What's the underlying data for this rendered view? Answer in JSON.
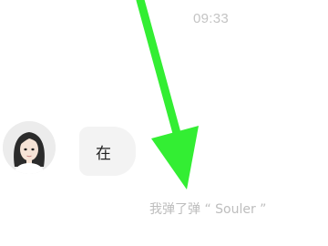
{
  "chat": {
    "timestamp": "09:33",
    "message": {
      "sender_avatar": "female-avatar",
      "text": "在"
    },
    "system_notice": "我弹了弹 “ Souler ”"
  },
  "overlay": {
    "arrow_color": "#33ee33",
    "arrow_icon": "green-arrow-annotation"
  }
}
